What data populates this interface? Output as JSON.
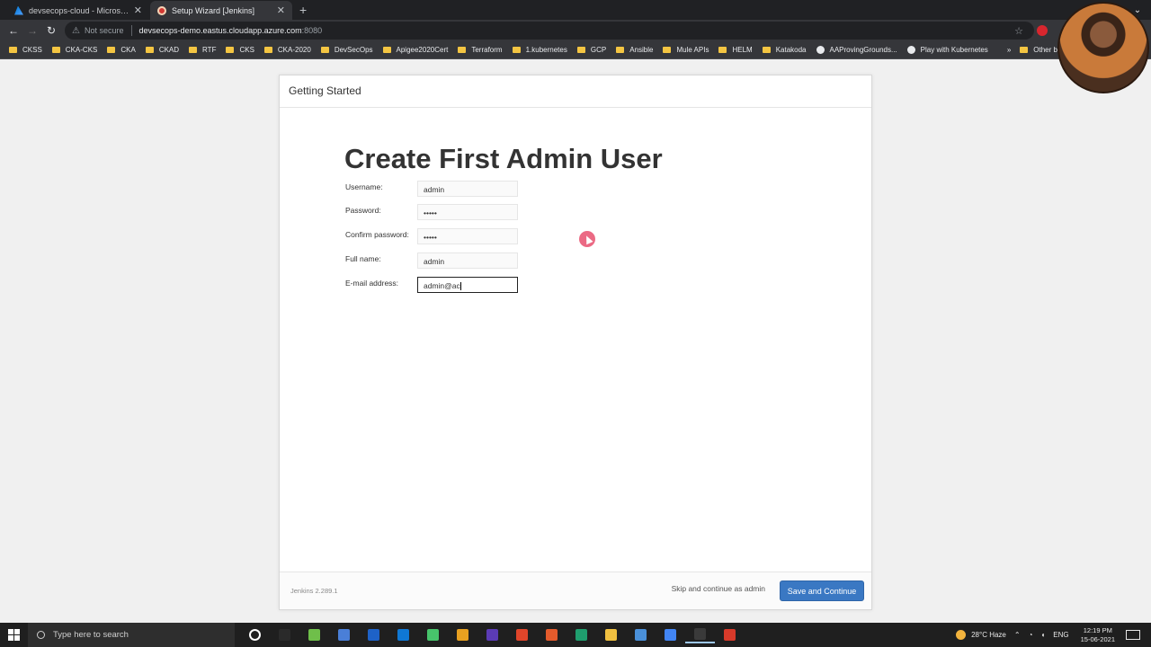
{
  "browser": {
    "tabs": [
      {
        "title": "devsecops-cloud - Microsoft Az",
        "active": false,
        "favicon": "azure-icon"
      },
      {
        "title": "Setup Wizard [Jenkins]",
        "active": true,
        "favicon": "jenkins-icon"
      }
    ],
    "security_label": "Not secure",
    "url_host": "devsecops-demo.eastus.cloudapp.azure.com",
    "url_port": ":8080",
    "bookmarks": [
      {
        "label": "CKSS",
        "icon": "folder"
      },
      {
        "label": "CKA-CKS",
        "icon": "folder"
      },
      {
        "label": "CKA",
        "icon": "folder"
      },
      {
        "label": "CKAD",
        "icon": "folder"
      },
      {
        "label": "RTF",
        "icon": "folder"
      },
      {
        "label": "CKS",
        "icon": "folder"
      },
      {
        "label": "CKA-2020",
        "icon": "folder"
      },
      {
        "label": "DevSecOps",
        "icon": "folder"
      },
      {
        "label": "Apigee2020Cert",
        "icon": "folder"
      },
      {
        "label": "Terraform",
        "icon": "folder"
      },
      {
        "label": "1.kubernetes",
        "icon": "folder"
      },
      {
        "label": "GCP",
        "icon": "folder"
      },
      {
        "label": "Ansible",
        "icon": "folder"
      },
      {
        "label": "Mule APIs",
        "icon": "folder"
      },
      {
        "label": "HELM",
        "icon": "folder"
      },
      {
        "label": "Katakoda",
        "icon": "folder"
      },
      {
        "label": "AAProvingGrounds...",
        "icon": "globe"
      },
      {
        "label": "Play with Kubernetes",
        "icon": "globe"
      }
    ],
    "more_bookmarks": "»",
    "other_bookmarks": "Other boo"
  },
  "wizard": {
    "header": "Getting Started",
    "title": "Create First Admin User",
    "fields": [
      {
        "label": "Username:",
        "value": "admin",
        "focused": false
      },
      {
        "label": "Password:",
        "value": "•••••",
        "focused": false
      },
      {
        "label": "Confirm password:",
        "value": "•••••",
        "focused": false
      },
      {
        "label": "Full name:",
        "value": "admin",
        "focused": false
      },
      {
        "label": "E-mail address:",
        "value": "admin@ac",
        "focused": true
      }
    ],
    "version": "Jenkins 2.289.1",
    "skip_label": "Skip and continue as admin",
    "save_label": "Save and Continue"
  },
  "taskbar": {
    "search_placeholder": "Type here to search",
    "weather": "28°C  Haze",
    "language": "ENG",
    "time": "12:19 PM",
    "date": "15-06-2021",
    "app_colors": [
      "#2a2a2a",
      "#2a2a2a",
      "#6fbf4a",
      "#4a7fd8",
      "#1e62c8",
      "#0f78d4",
      "#47c46b",
      "#e8a020",
      "#5b3bb5",
      "#e0452a",
      "#e45b2c",
      "#1f9e6e",
      "#f0c040",
      "#4a90d9",
      "#4285f4",
      "#3a3a3a",
      "#d73a2a"
    ]
  }
}
